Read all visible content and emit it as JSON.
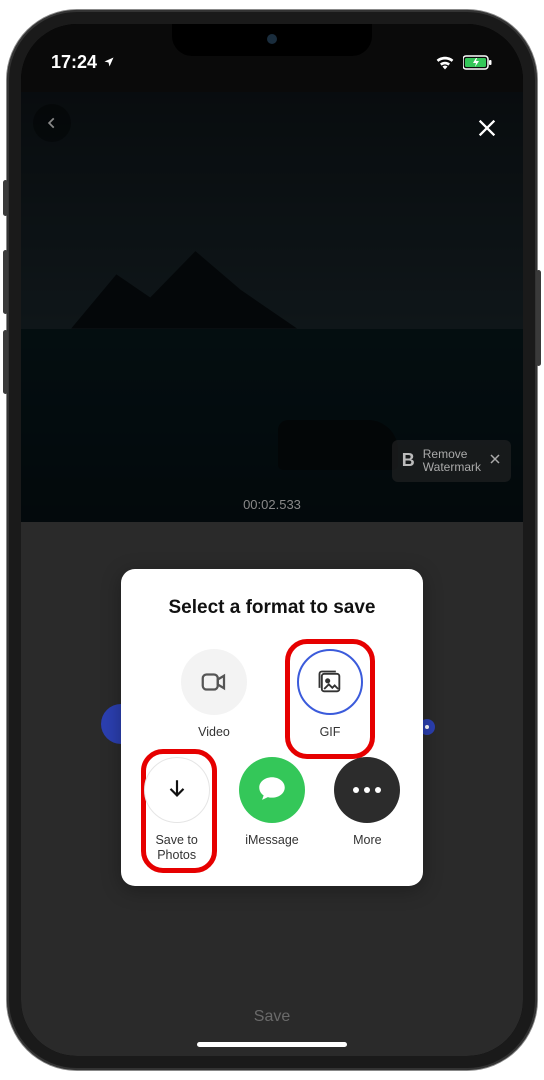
{
  "status": {
    "time": "17:24",
    "location_arrow": "↑"
  },
  "video": {
    "timestamp": "00:02.533"
  },
  "watermark": {
    "logo": "B",
    "line1": "Remove",
    "line2": "Watermark"
  },
  "modal": {
    "title": "Select a format to save",
    "video_label": "Video",
    "gif_label": "GIF",
    "save_label": "Save to Photos",
    "imessage_label": "iMessage",
    "more_label": "More"
  },
  "footer": {
    "save": "Save"
  }
}
